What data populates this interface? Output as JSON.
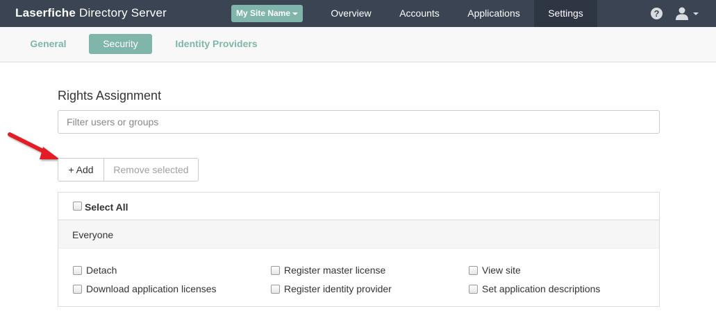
{
  "header": {
    "brand_bold": "Laserfiche",
    "brand_rest": " Directory Server",
    "site_selector": "My Site Name",
    "nav": [
      "Overview",
      "Accounts",
      "Applications",
      "Settings"
    ],
    "active_nav": "Settings",
    "help_glyph": "?",
    "icons": [
      "help-icon",
      "user-icon",
      "chevron-down-icon"
    ]
  },
  "subnav": {
    "tabs": [
      "General",
      "Security",
      "Identity Providers"
    ],
    "active_tab": "Security"
  },
  "main": {
    "title": "Rights Assignment",
    "filter_placeholder": "Filter users or groups",
    "add_label": "+ Add",
    "remove_label": "Remove selected",
    "select_all_label": "Select All",
    "group_name": "Everyone",
    "rights": [
      [
        "Detach",
        "Register master license",
        "View site"
      ],
      [
        "Download application licenses",
        "Register identity provider",
        "Set application descriptions"
      ]
    ]
  },
  "colors": {
    "navbar": "#3b4452",
    "accent": "#7fb5aa",
    "arrow": "#e41e26"
  }
}
